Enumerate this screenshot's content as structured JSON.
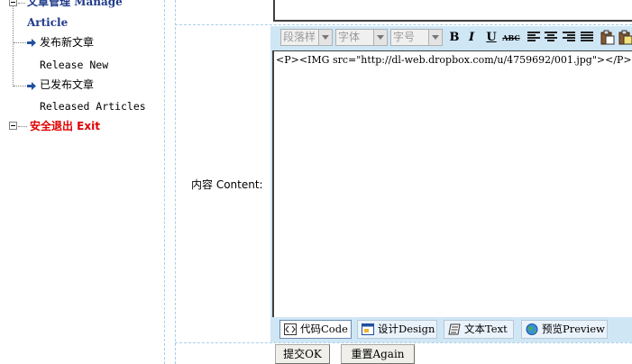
{
  "sidebar": {
    "manage_label": "文章管理 Manage",
    "article_label": "Article",
    "publish_new_cn": "发布新文章",
    "publish_new_en": "Release New",
    "published_cn": "已发布文章",
    "published_en": "Released Articles",
    "exit_label": "安全退出 Exit"
  },
  "form": {
    "content_label": "内容 Content:"
  },
  "editor": {
    "toolbar": {
      "paragraph_style": "段落样",
      "font": "字体",
      "font_size": "字号",
      "bold": "B",
      "italic": "I",
      "underline": "U",
      "strikethrough": "ABC"
    },
    "code": "<P><IMG src=\"http://dl-web.dropbox.com/u/4759692/001.jpg\"></P>",
    "modes": {
      "code": "代码Code",
      "design": "设计Design",
      "text": "文本Text",
      "preview": "预览Preview"
    }
  },
  "buttons": {
    "submit": "提交OK",
    "reset": "重置Again"
  },
  "colors": {
    "tree_blue": "#1f3a8a",
    "exit_red": "#e00000",
    "editor_bg": "#cfe6f5"
  }
}
